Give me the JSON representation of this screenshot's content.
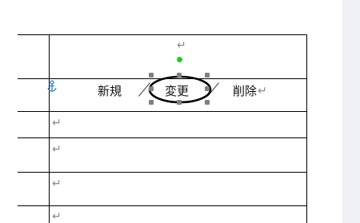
{
  "table": {
    "row2": {
      "left_label": "新規",
      "center_label": "変更",
      "right_label": "削除"
    }
  },
  "marks": {
    "paragraph": "↵"
  },
  "icons": {
    "anchor": "anchor-icon"
  },
  "colors": {
    "rotation_handle": "#22cc22",
    "resize_handle": "#808080",
    "anchor": "#2a7fd4",
    "paragraph_mark": "#8a8a8a"
  }
}
